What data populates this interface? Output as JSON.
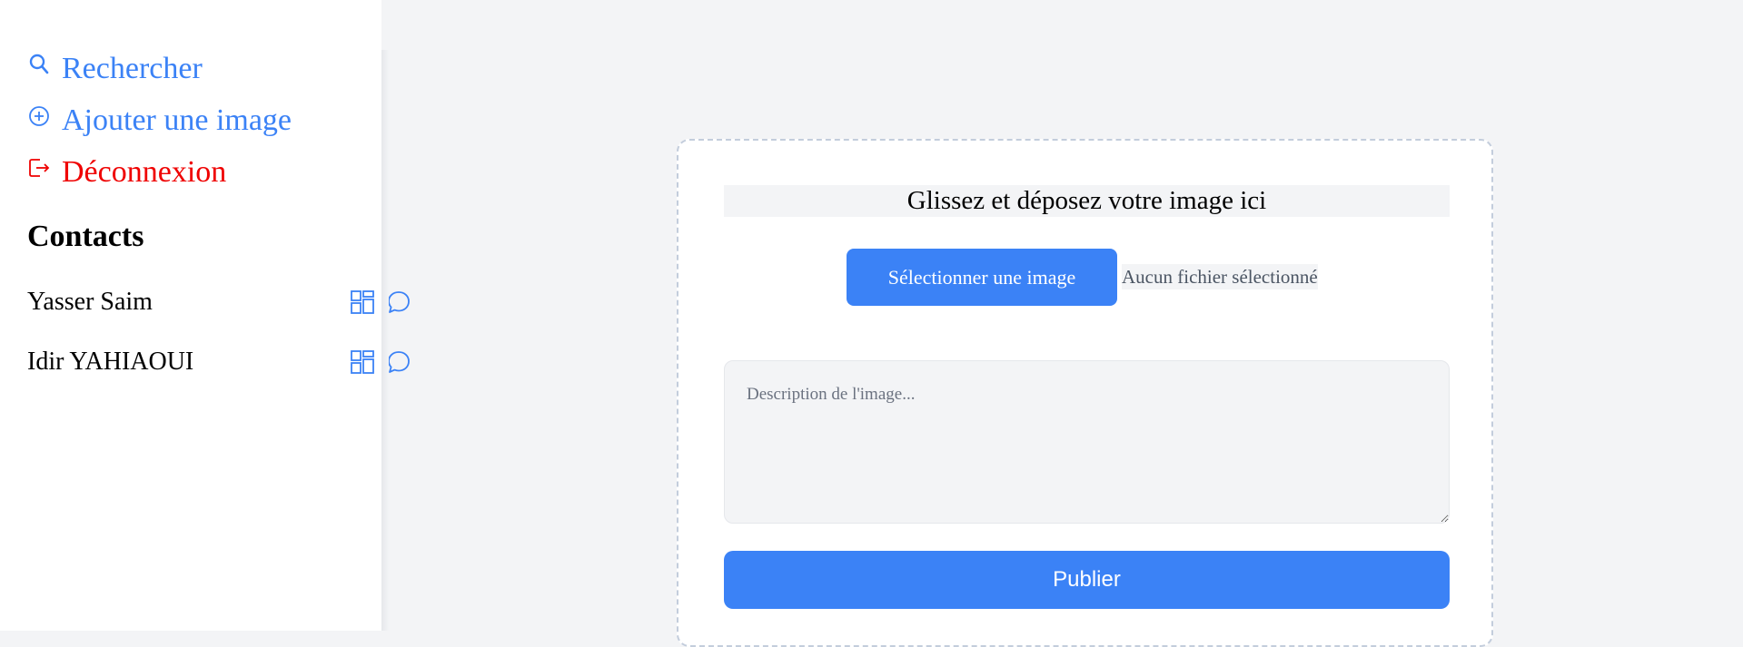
{
  "sidebar": {
    "nav": {
      "search_label": "Rechercher",
      "add_image_label": "Ajouter une image",
      "logout_label": "Déconnexion"
    },
    "contacts_title": "Contacts",
    "contacts": [
      {
        "name": "Yasser Saim"
      },
      {
        "name": "Idir YAHIAOUI"
      }
    ]
  },
  "upload": {
    "drop_label": "Glissez et déposez votre image ici",
    "select_button": "Sélectionner une image",
    "file_status": "Aucun fichier sélectionné",
    "description_placeholder": "Description de l'image...",
    "publish_button": "Publier"
  },
  "colors": {
    "accent": "#3b82f6",
    "danger": "#ef0000",
    "background": "#f3f4f6"
  },
  "icons": {
    "search": "search-icon",
    "add": "plus-circle-icon",
    "logout": "logout-icon",
    "gallery": "grid-icon",
    "message": "chat-bubble-icon"
  }
}
